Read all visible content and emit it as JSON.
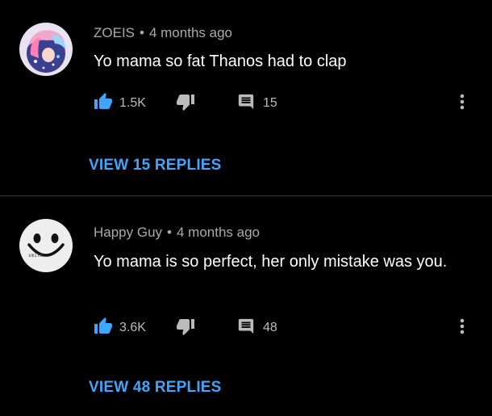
{
  "comments": [
    {
      "author": "ZOEIS",
      "separator": "•",
      "time": "4 months ago",
      "text": "Yo mama so fat Thanos had to clap",
      "likes": "1.5K",
      "replies": "15",
      "view_replies_label": "VIEW 15 REPLIES",
      "avatar_icon": "anime-character-avatar"
    },
    {
      "author": "Happy Guy",
      "separator": "•",
      "time": "4 months ago",
      "text": "Yo mama is so perfect, her only mistake was you.",
      "likes": "3.6K",
      "replies": "48",
      "view_replies_label": "VIEW 48 REPLIES",
      "avatar_icon": "smiley-face-avatar",
      "avatar_text": "smile"
    }
  ],
  "colors": {
    "background": "#000000",
    "accent_blue": "#3ea6ff",
    "meta_gray": "#aaaaaa",
    "text_white": "#ffffff",
    "divider": "#3a3a3a"
  }
}
